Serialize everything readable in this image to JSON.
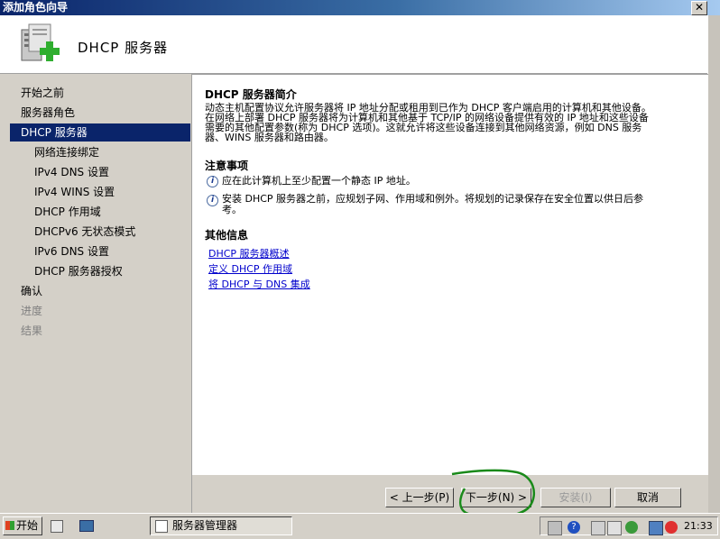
{
  "window": {
    "title": "添加角色向导",
    "close_glyph": "✕"
  },
  "header": {
    "title": "DHCP  服务器",
    "icon": "server-add-icon"
  },
  "nav": {
    "items": [
      {
        "label": "开始之前"
      },
      {
        "label": "服务器角色"
      },
      {
        "label": "DHCP 服务器"
      },
      {
        "label": "网络连接绑定"
      },
      {
        "label": "IPv4 DNS 设置"
      },
      {
        "label": "IPv4 WINS 设置"
      },
      {
        "label": "DHCP 作用域"
      },
      {
        "label": "DHCPv6 无状态模式"
      },
      {
        "label": "IPv6 DNS 设置"
      },
      {
        "label": "DHCP 服务器授权"
      },
      {
        "label": "确认"
      },
      {
        "label": "进度"
      },
      {
        "label": "结果"
      }
    ],
    "selected_index": 2
  },
  "content": {
    "intro_heading": "DHCP 服务器简介",
    "intro_lines": [
      "动态主机配置协议允许服务器将 IP 地址分配或租用到已作为 DHCP 客户端启用的计算机和其他设备。",
      "在网络上部署 DHCP 服务器将为计算机和其他基于 TCP/IP 的网络设备提供有效的 IP 地址和这些设备",
      "需要的其他配置参数(称为 DHCP 选项)。这就允许将这些设备连接到其他网络资源，例如 DNS 服务",
      "器、WINS 服务器和路由器。"
    ],
    "notes_heading": "注意事项",
    "note1": "应在此计算机上至少配置一个静态 IP 地址。",
    "note2_line1": "安装 DHCP 服务器之前，应规划子网、作用域和例外。将规划的记录保存在安全位置以供日后参",
    "note2_line2": "考。",
    "more_heading": "其他信息",
    "links": [
      "DHCP 服务器概述",
      "定义 DHCP 作用域",
      "将 DHCP 与 DNS 集成"
    ]
  },
  "buttons": {
    "prev": "< 上一步(P)",
    "next": "下一步(N) >",
    "install": "安装(I)",
    "cancel": "取消"
  },
  "taskbar": {
    "start": "开始",
    "task_item": "服务器管理器",
    "clock": "21:33"
  },
  "colors": {
    "selection": "#0a246a",
    "link": "#0000cc",
    "annotation": "#1a8a1a"
  }
}
